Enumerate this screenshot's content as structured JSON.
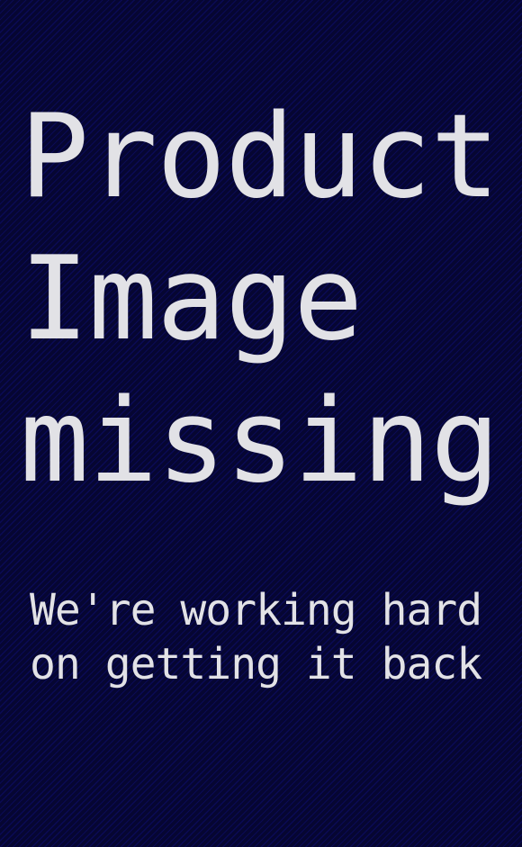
{
  "headline": {
    "line1": "Product",
    "line2": "Image",
    "line3": "missing"
  },
  "message": {
    "line1": "We're working hard",
    "line2": "on getting it back"
  },
  "colors": {
    "background": "#07073a",
    "stripe": "#0a0a55",
    "text": "#e2e2e6"
  }
}
